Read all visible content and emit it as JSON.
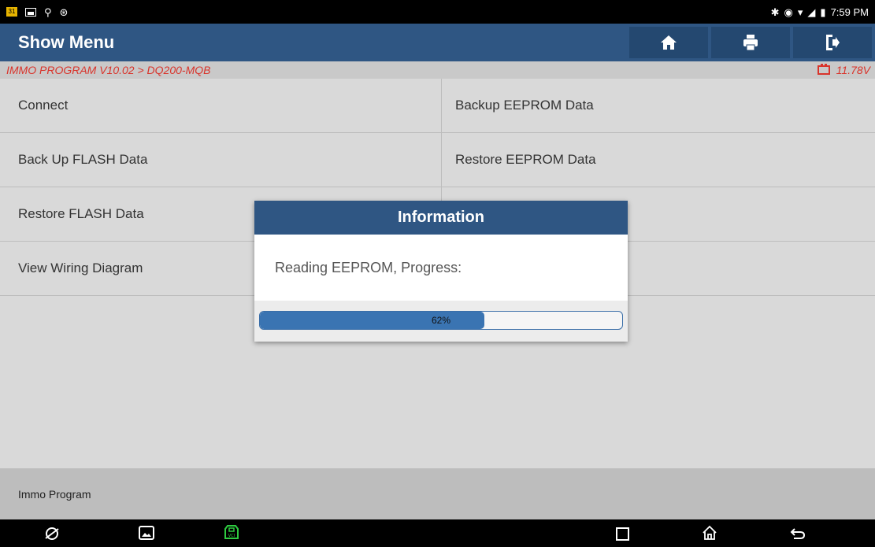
{
  "status_bar": {
    "time": "7:59 PM",
    "calendar_day": "31"
  },
  "header": {
    "title": "Show Menu"
  },
  "breadcrumb": {
    "path": "IMMO PROGRAM V10.02 > DQ200-MQB",
    "voltage": "11.78V"
  },
  "menu": {
    "items": [
      {
        "label": "Connect"
      },
      {
        "label": "Backup EEPROM Data"
      },
      {
        "label": "Back Up FLASH Data"
      },
      {
        "label": "Restore EEPROM Data"
      },
      {
        "label": "Restore FLASH Data"
      },
      {
        "label": ""
      },
      {
        "label": "View Wiring Diagram"
      },
      {
        "label": ""
      }
    ]
  },
  "footer": {
    "label": "Immo Program"
  },
  "dialog": {
    "title": "Information",
    "message": "Reading EEPROM, Progress:",
    "progress_percent": 62,
    "progress_label": "62%"
  },
  "colors": {
    "header_bg": "#2f5683",
    "accent_red": "#d9342b",
    "progress_fill": "#3a74b2"
  },
  "icons": {
    "toolbar": [
      "home-icon",
      "print-icon",
      "exit-icon"
    ],
    "nav": [
      "browser-icon",
      "gallery-icon",
      "vci-icon",
      "recent-apps-icon",
      "home-nav-icon",
      "back-icon"
    ]
  }
}
